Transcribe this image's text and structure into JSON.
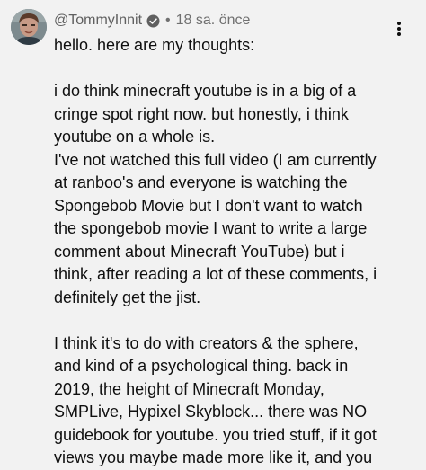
{
  "comment": {
    "author": "@TommyInnit",
    "verified_icon": "verified-check-icon",
    "separator": "•",
    "time_ago": "18 sa. önce",
    "menu_icon": "more-vertical-icon",
    "lines": [
      "hello. here are my thoughts:",
      "",
      "i do think minecraft youtube is in a big of a",
      "cringe spot right now. but honestly, i think",
      "youtube on a whole is.",
      "I've not watched this full video (I am currently",
      "at ranboo's and everyone is watching the",
      "Spongebob Movie but I don't want to watch",
      "the spongebob movie I want to write a large",
      "comment about Minecraft YouTube) but i",
      "think, after reading a lot of these comments, i",
      "definitely get the jist.",
      "",
      "I think it's to do with creators & the sphere,",
      "and kind of a psychological thing. back in",
      "2019, the height of Minecraft Monday,",
      "SMPLive, Hypixel Skyblock... there was NO",
      "guidebook for youtube. you tried stuff, if it got",
      "views you maybe made more like it, and you"
    ]
  }
}
